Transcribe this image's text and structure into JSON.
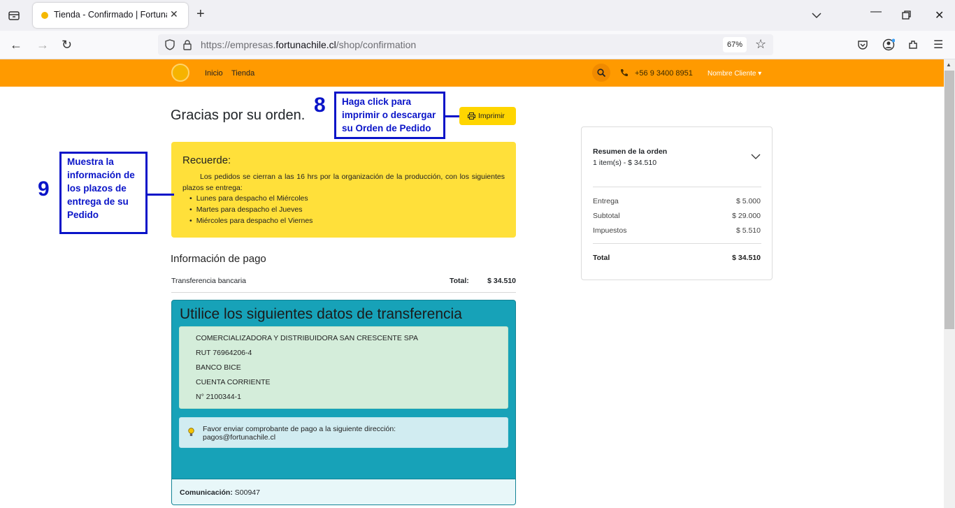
{
  "browser": {
    "tab_title": "Tienda - Confirmado | Fortuna",
    "url_prefix": "https://empresas.",
    "url_domain": "fortunachile.cl",
    "url_path": "/shop/confirmation",
    "zoom": "67%"
  },
  "header": {
    "nav": [
      "Inicio",
      "Tienda"
    ],
    "phone": "+56 9 3400 8951",
    "client_menu": "Nombre Cliente ▾"
  },
  "page": {
    "title": "Gracias por su orden.",
    "print_label": "Imprimir"
  },
  "notice": {
    "title": "Recuerde:",
    "text": "Los pedidos se cierran a las 16 hrs por la organización de la producción, con los siguientes plazos se entrega:",
    "items": [
      "Lunes para despacho el Miércoles",
      "Martes para despacho el Jueves",
      "Miércoles para despacho el Viernes"
    ]
  },
  "payment": {
    "title": "Información de pago",
    "method": "Transferencia bancaria",
    "total_label": "Total:",
    "total": "$ 34.510"
  },
  "transfer": {
    "title": "Utilice los siguientes datos de transferencia",
    "bank_lines": [
      "COMERCIALIZADORA Y DISTRIBUIDORA SAN CRESCENTE SPA",
      "RUT 76964206-4",
      "BANCO BICE",
      "CUENTA CORRIENTE",
      "N° 2100344-1"
    ],
    "hint_line1": "Favor enviar comprobante de pago a la siguiente dirección:",
    "hint_line2": "pagos@fortunachile.cl",
    "comm_label": "Comunicación:",
    "comm_value": "S00947"
  },
  "summary": {
    "title": "Resumen de la orden",
    "items": "1 item(s) -  $ 34.510",
    "rows": [
      {
        "label": "Entrega",
        "value": "$ 5.000"
      },
      {
        "label": "Subtotal",
        "value": "$ 29.000"
      },
      {
        "label": "Impuestos",
        "value": "$ 5.510"
      }
    ],
    "total_label": "Total",
    "total_value": "$ 34.510"
  },
  "annotations": {
    "n8": "8",
    "n8_text": "Haga click para imprimir o descargar su Orden de Pedido",
    "n9": "9",
    "n9_text": "Muestra la información de los plazos de entrega de su Pedido"
  },
  "colors": {
    "header": "#ff9a00",
    "notice": "#ffe03a",
    "transfer": "#17a2b8",
    "annotation": "#0a14c8"
  }
}
